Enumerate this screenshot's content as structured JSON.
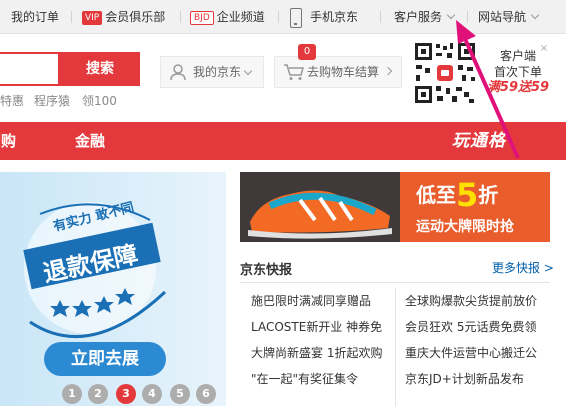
{
  "topbar": {
    "my_orders": "我的订单",
    "vip_badge": "VIP",
    "vip_club": "会员俱乐部",
    "bjd_badge": "BJD",
    "enterprise": "企业频道",
    "mobile_jd": "手机京东",
    "customer_service": "客户服务",
    "site_nav": "网站导航"
  },
  "search": {
    "button_label": "搜索",
    "hot_words": [
      "特惠",
      "程序猿",
      "领100"
    ]
  },
  "header": {
    "my_jd": "我的京东",
    "cart_label": "去购物车结算",
    "cart_count": "0",
    "qr_line1": "客户端",
    "qr_line2": "首次下单",
    "qr_promo": "满59送59",
    "qr_close": "×"
  },
  "nav": {
    "items": [
      "团购",
      "金融"
    ],
    "fun": "玩通格"
  },
  "banner": {
    "stamp_line1": "有实力 敢不同",
    "stamp_main": "退款保障",
    "cta": "立即去展",
    "pages": [
      "1",
      "2",
      "3",
      "4",
      "5",
      "6"
    ],
    "active_page": 3
  },
  "ad": {
    "title_prefix": "低至",
    "title_number": "5",
    "title_suffix": "折",
    "subtitle": "运动大牌限时抢"
  },
  "news": {
    "title": "京东快报",
    "more": "更多快报 >",
    "left": [
      "施巴限时满减同享赠品",
      "LACOSTE新开业 神券免",
      "大牌尚新盛宴 1折起欢购",
      "\"在一起\"有奖征集令"
    ],
    "right": [
      "全球购爆款尖货提前放价",
      "会员狂欢 5元话费免费领",
      "重庆大件运营中心搬迁公",
      "京东JD+计划新品发布"
    ]
  },
  "colors": {
    "brand_red": "#e4393c",
    "link_blue": "#005ea7",
    "cta_blue": "#2c8ad3"
  }
}
